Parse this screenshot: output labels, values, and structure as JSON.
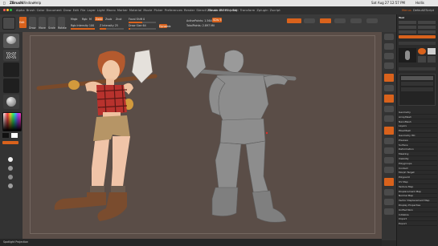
{
  "menubar": {
    "apple": "",
    "app_name": "ZBrush",
    "window_menu": "Window",
    "help_menu": "Help",
    "clock": "Sat Aug 27  12:57 PM",
    "user": "Hollis"
  },
  "app": {
    "title": "ZBrush 4R7 P3 (x64)",
    "menus_left": [
      "Alpha",
      "Brush",
      "Color",
      "Document",
      "Draw",
      "Edit",
      "File",
      "Layer",
      "Light",
      "Macro",
      "Marker",
      "Material",
      "Movie",
      "Picker",
      "Preferences",
      "Render",
      "Stencil",
      "Stroke",
      "Texture",
      "Tool",
      "Transform",
      "Zplugin",
      "Zscript"
    ],
    "right_items": [
      "Menus",
      "DefaultZScript"
    ]
  },
  "toolbar": {
    "edit_label": "Edit",
    "draw_label": "Draw",
    "move_label": "Move",
    "scale_label": "Scale",
    "rotate_label": "Rotate",
    "mrgb_label": "Mrgb",
    "rgb_label": "Rgb",
    "m_label": "M",
    "zadd_label": "Zadd",
    "zsub_label": "Zsub",
    "zcut_label": "Zcut",
    "focal_shift_label": "Focal Shift 0",
    "draw_size_label": "Draw Size 64",
    "dynamic_label": "Dynamic",
    "rgb_intensity_label": "Rgb Intensity 100",
    "z_intensity_label": "Z Intensity 25",
    "active_points_label": "ActivePoints: 1.564 Mil",
    "total_points_label": "TotalPoints: 2.897 Mil",
    "sdiv_label": "SDiv 5",
    "focal_shift": 0,
    "draw_size": 64,
    "rgb_intensity": 100,
    "z_intensity": 25
  },
  "left_tray": {
    "items": [
      "Standard",
      "Dots",
      "Alpha Off",
      "Texture Off",
      "MatCap Gray",
      "Gradient",
      "SwitchColor",
      "Alternate"
    ]
  },
  "right_strip": {
    "buttons": [
      "BPR",
      "SPix 3",
      "Scroll",
      "Zoom",
      "Actual",
      "AAHalf",
      "Dynamic Persp",
      "Floor",
      "Local",
      "LSym",
      "Gxyz",
      "Frame",
      "Move",
      "Scale",
      "Rotate",
      "Line Fill PolyF",
      "Transp",
      "Ghost",
      "Solo",
      "Xpose"
    ]
  },
  "right_panel": {
    "header": "Tool",
    "items": [
      "Load Tool",
      "Save As",
      "Copy Tool",
      "Paste Tool",
      "Import",
      "Export",
      "Clone",
      "Make PolyMesh3D",
      "GoZ",
      "All",
      "Visible",
      "R",
      "Lightbox > Tools",
      "PM3D_Nikki_Body 48",
      "Subtool",
      "Geometry",
      "ArrayMesh",
      "NanoMesh",
      "Layers",
      "FiberMesh",
      "Geometry HD",
      "Preview",
      "Surface",
      "Deformation",
      "Masking",
      "Visibility",
      "Polygroups",
      "Contact",
      "Morph Target",
      "Polypaint",
      "UV Map",
      "Texture Map",
      "Displacement Map",
      "Normal Map",
      "Vector Displacement Map",
      "Display Properties",
      "Unified Skin",
      "Initialize",
      "Import",
      "Export"
    ]
  },
  "status": {
    "text": "Spotlight Projection"
  },
  "colors": {
    "accent": "#d9621c",
    "canvas_bg": "#5a4d47",
    "panel_bg": "#2b2b2b",
    "toolbar_bg": "#3a3a3a"
  }
}
